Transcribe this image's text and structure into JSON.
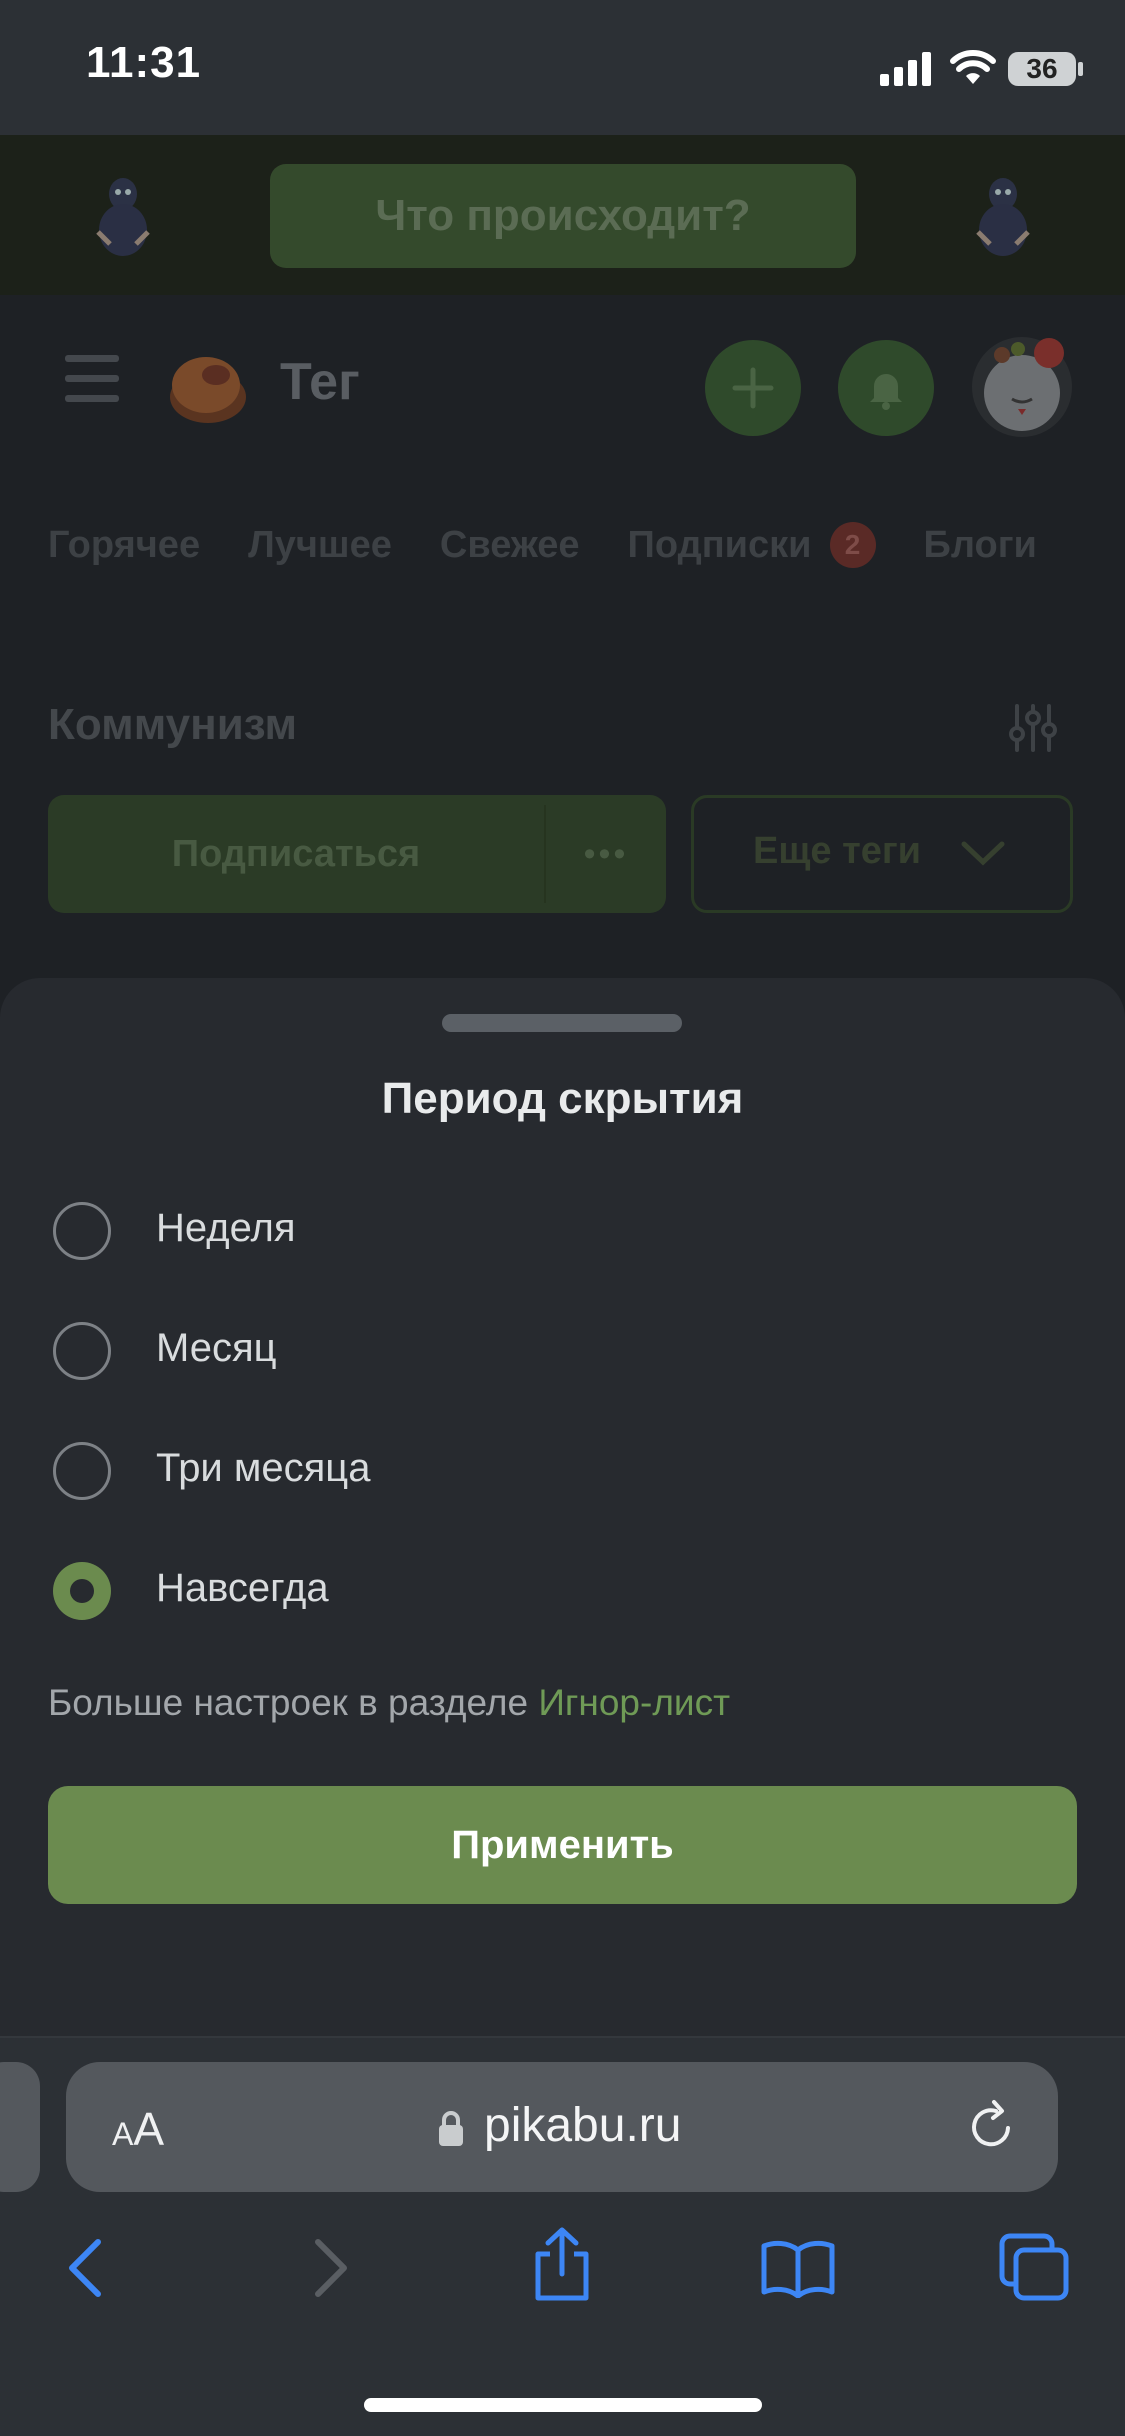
{
  "status_bar": {
    "time": "11:31",
    "battery": "36"
  },
  "background_page": {
    "ask_box_text": "Что происходит?",
    "header": {
      "title": "Тег"
    },
    "tabs": [
      {
        "label": "Горячее"
      },
      {
        "label": "Лучшее"
      },
      {
        "label": "Свежее"
      },
      {
        "label": "Подписки",
        "badge": "2"
      },
      {
        "label": "Блоги"
      }
    ],
    "topic": {
      "title": "Коммунизм",
      "subscribe_label": "Подписаться",
      "more_label": "•••",
      "more_tags_label": "Еще теги"
    }
  },
  "sheet": {
    "title": "Период скрытия",
    "options": [
      {
        "label": "Неделя",
        "selected": false
      },
      {
        "label": "Месяц",
        "selected": false
      },
      {
        "label": "Три месяца",
        "selected": false
      },
      {
        "label": "Навсегда",
        "selected": true
      }
    ],
    "hint_prefix": "Больше настроек в разделе ",
    "hint_link": "Игнор-лист",
    "apply_label": "Применить"
  },
  "browser": {
    "aa_small": "A",
    "aa_large": "A",
    "url": "pikabu.ru"
  },
  "colors": {
    "accent_green": "#6b8b4f",
    "sheet_background": "#272a2f",
    "link_green": "#6f9a56"
  },
  "icons": [
    "menu-icon",
    "plus-icon",
    "bell-icon",
    "filter-icon",
    "chevron-down-icon",
    "lock-icon",
    "reload-icon",
    "back-icon",
    "forward-icon",
    "share-icon",
    "bookmarks-icon",
    "tabs-icon",
    "wifi-icon",
    "signal-icon",
    "battery-icon"
  ]
}
